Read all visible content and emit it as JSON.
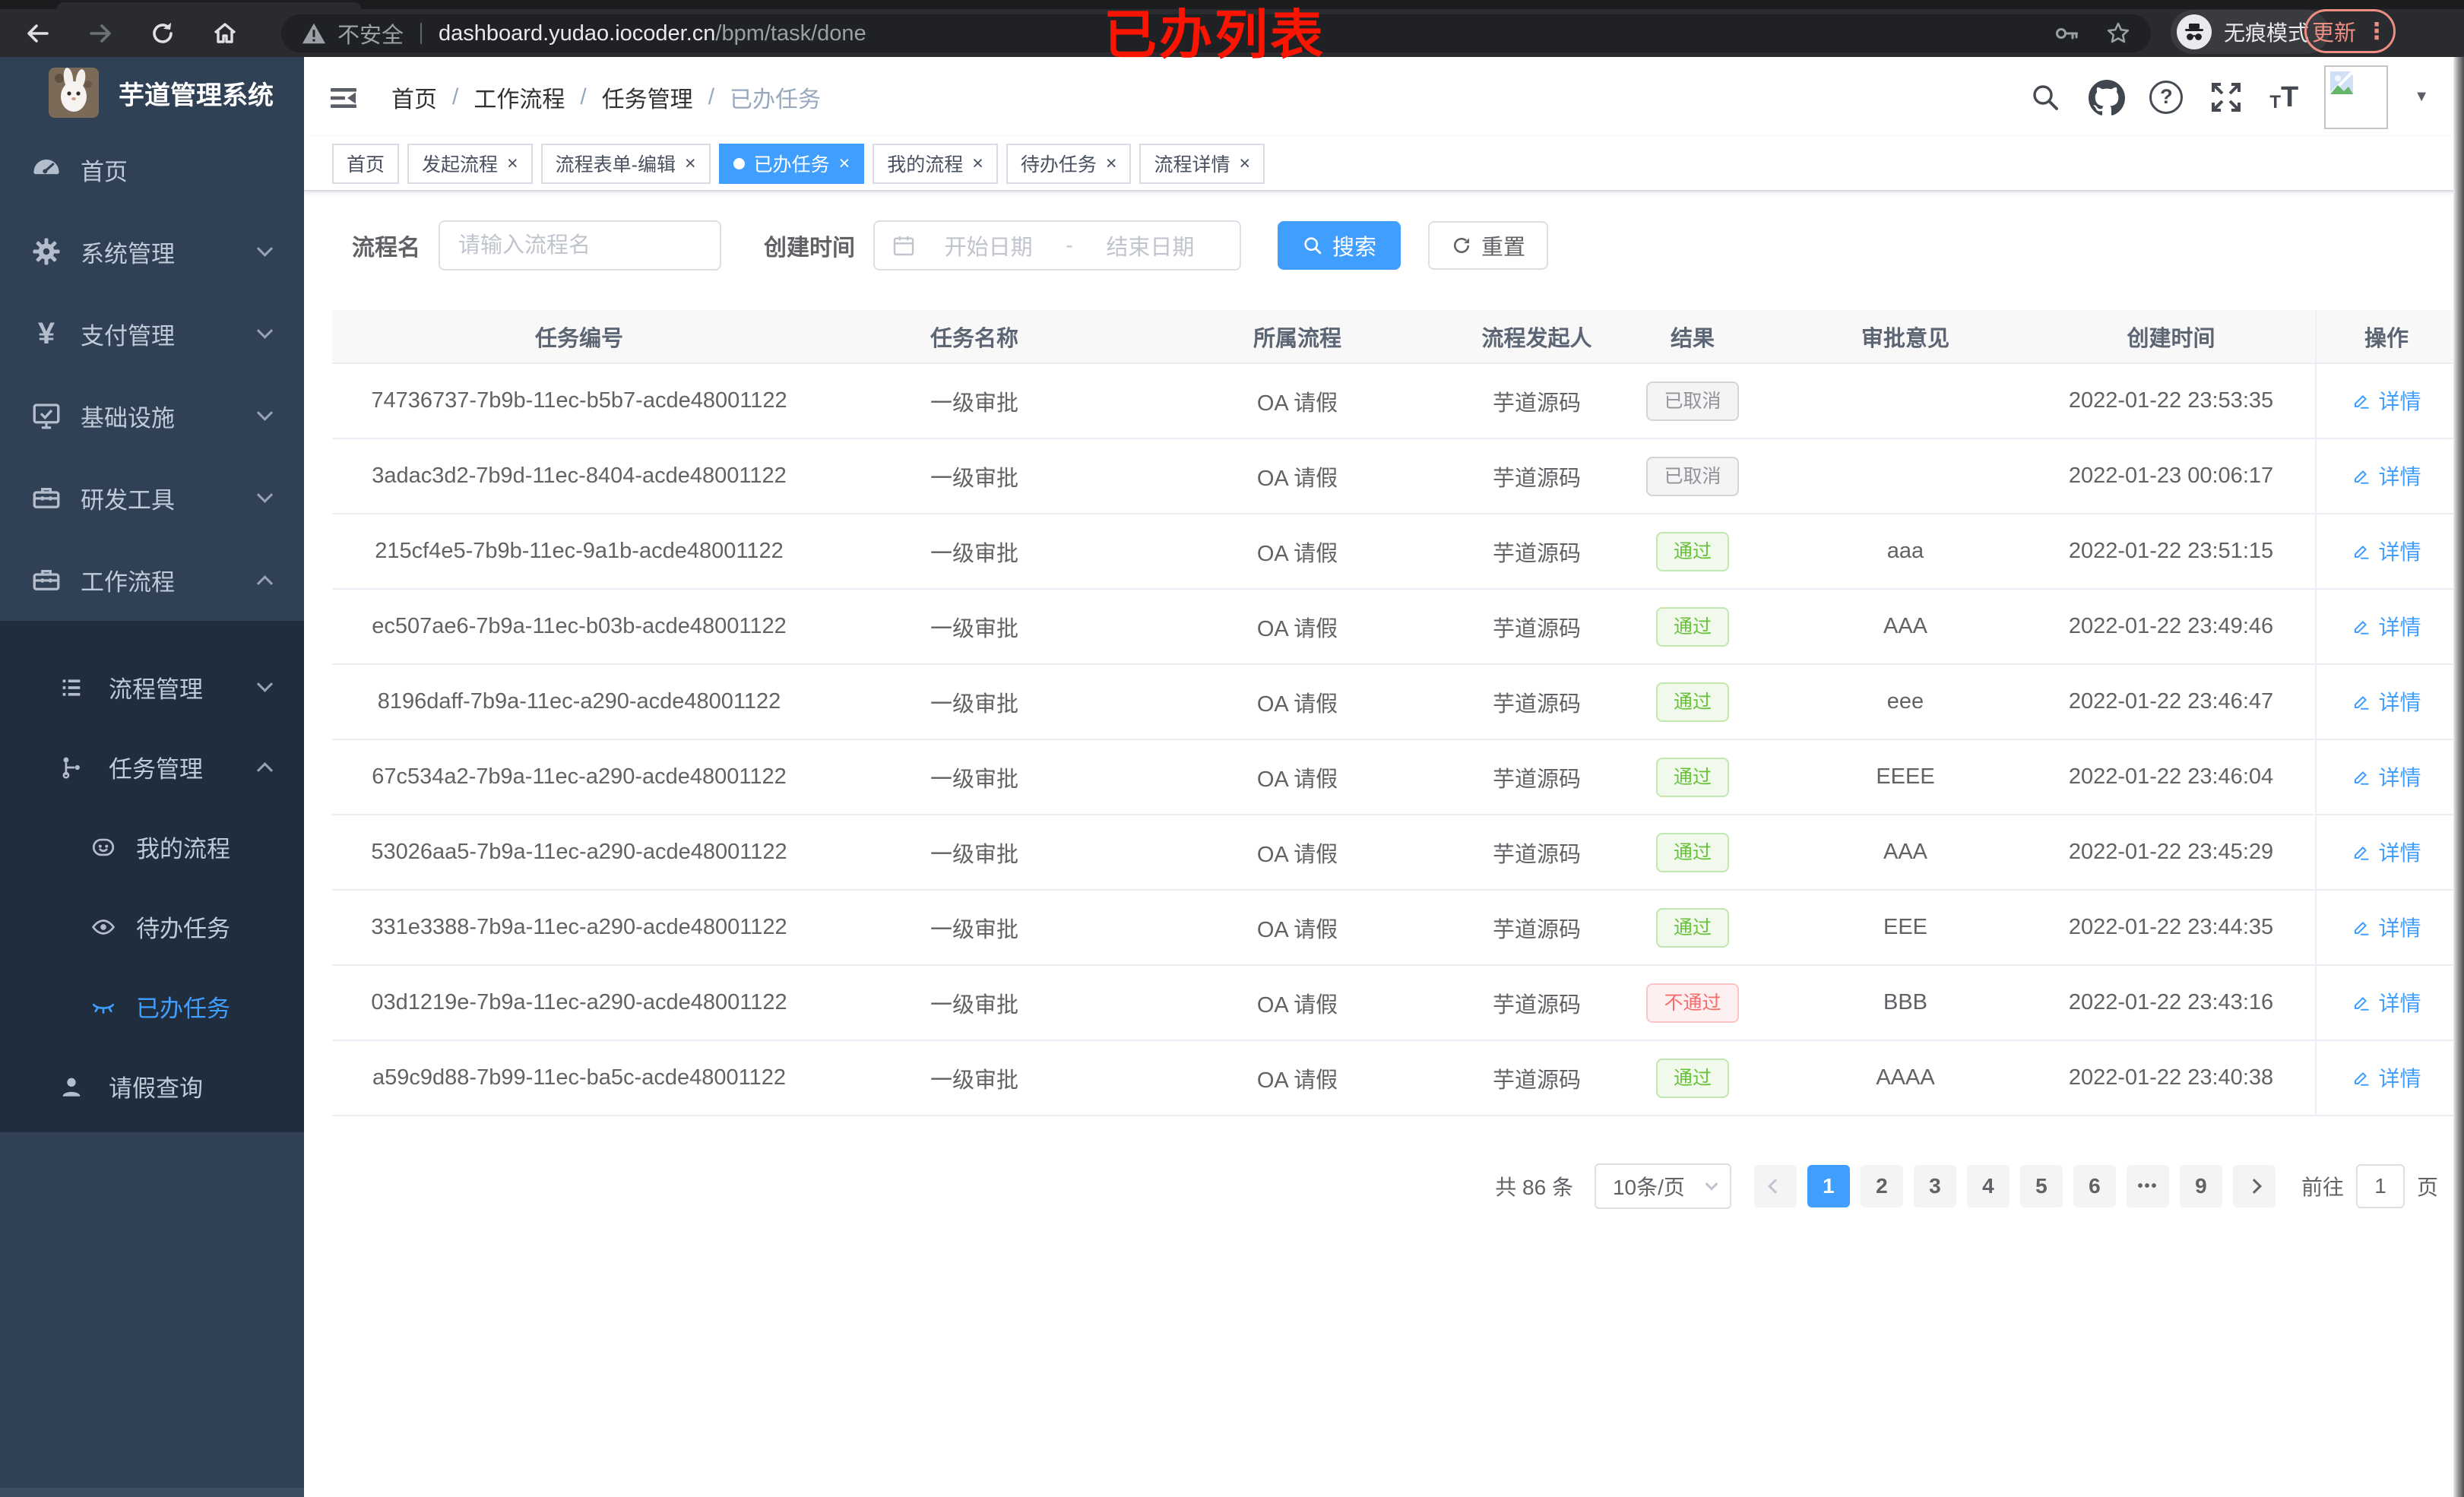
{
  "browser": {
    "security_label": "不安全",
    "url_host": "dashboard.yudao.iocoder.cn",
    "url_path": "/bpm/task/done",
    "incognito_label": "无痕模式",
    "update_label": "更新",
    "annotation": "已办列表"
  },
  "glyphs": {
    "close": "×",
    "dots_vertical": "⋮",
    "caret_down": "▼"
  },
  "icons": {
    "browser": [
      "back-arrow",
      "forward-arrow",
      "reload",
      "home",
      "warning-triangle",
      "key",
      "star",
      "incognito-hat-glasses",
      "kebab-dots"
    ],
    "navbar": [
      "hamburger-fold",
      "search",
      "github",
      "question",
      "fullscreen",
      "text-size",
      "broken-image-avatar",
      "caret-down"
    ],
    "sidebar": [
      "gauge",
      "gear",
      "yen",
      "monitor-check",
      "toolbox",
      "list",
      "flow-tree",
      "face",
      "eye",
      "eye-closed",
      "person"
    ],
    "actions": [
      "magnifier",
      "refresh",
      "calendar",
      "pen-edit"
    ]
  },
  "sidebar": {
    "logo_title": "芋道管理系统",
    "items": [
      {
        "label": "首页"
      },
      {
        "label": "系统管理",
        "chevron": "down"
      },
      {
        "label": "支付管理",
        "chevron": "down"
      },
      {
        "label": "基础设施",
        "chevron": "down"
      },
      {
        "label": "研发工具",
        "chevron": "down"
      },
      {
        "label": "工作流程",
        "chevron": "up"
      }
    ],
    "submenu": [
      {
        "label": "流程管理",
        "chevron": "down"
      },
      {
        "label": "任务管理",
        "chevron": "up"
      },
      {
        "label": "我的流程"
      },
      {
        "label": "待办任务"
      },
      {
        "label": "已办任务",
        "active": true
      },
      {
        "label": "请假查询"
      }
    ]
  },
  "breadcrumb": {
    "separator": "/",
    "items": [
      "首页",
      "工作流程",
      "任务管理",
      "已办任务"
    ]
  },
  "tabs": [
    {
      "label": "首页",
      "closable": false,
      "active": false
    },
    {
      "label": "发起流程",
      "closable": true,
      "active": false
    },
    {
      "label": "流程表单-编辑",
      "closable": true,
      "active": false
    },
    {
      "label": "已办任务",
      "closable": true,
      "active": true
    },
    {
      "label": "我的流程",
      "closable": true,
      "active": false
    },
    {
      "label": "待办任务",
      "closable": true,
      "active": false
    },
    {
      "label": "流程详情",
      "closable": true,
      "active": false
    }
  ],
  "filters": {
    "process_name_label": "流程名",
    "process_name_placeholder": "请输入流程名",
    "create_time_label": "创建时间",
    "start_placeholder": "开始日期",
    "range_separator": "-",
    "end_placeholder": "结束日期",
    "search_label": "搜索",
    "reset_label": "重置"
  },
  "table": {
    "columns": [
      "任务编号",
      "任务名称",
      "所属流程",
      "流程发起人",
      "结果",
      "审批意见",
      "创建时间",
      "操作"
    ],
    "detail_label": "详情",
    "rows": [
      {
        "id": "74736737-7b9b-11ec-b5b7-acde48001122",
        "name": "一级审批",
        "process": "OA 请假",
        "starter": "芋道源码",
        "result": "已取消",
        "result_type": "info",
        "opinion": "",
        "created": "2022-01-22 23:53:35"
      },
      {
        "id": "3adac3d2-7b9d-11ec-8404-acde48001122",
        "name": "一级审批",
        "process": "OA 请假",
        "starter": "芋道源码",
        "result": "已取消",
        "result_type": "info",
        "opinion": "",
        "created": "2022-01-23 00:06:17"
      },
      {
        "id": "215cf4e5-7b9b-11ec-9a1b-acde48001122",
        "name": "一级审批",
        "process": "OA 请假",
        "starter": "芋道源码",
        "result": "通过",
        "result_type": "success",
        "opinion": "aaa",
        "created": "2022-01-22 23:51:15"
      },
      {
        "id": "ec507ae6-7b9a-11ec-b03b-acde48001122",
        "name": "一级审批",
        "process": "OA 请假",
        "starter": "芋道源码",
        "result": "通过",
        "result_type": "success",
        "opinion": "AAA",
        "created": "2022-01-22 23:49:46"
      },
      {
        "id": "8196daff-7b9a-11ec-a290-acde48001122",
        "name": "一级审批",
        "process": "OA 请假",
        "starter": "芋道源码",
        "result": "通过",
        "result_type": "success",
        "opinion": "eee",
        "created": "2022-01-22 23:46:47"
      },
      {
        "id": "67c534a2-7b9a-11ec-a290-acde48001122",
        "name": "一级审批",
        "process": "OA 请假",
        "starter": "芋道源码",
        "result": "通过",
        "result_type": "success",
        "opinion": "EEEE",
        "created": "2022-01-22 23:46:04"
      },
      {
        "id": "53026aa5-7b9a-11ec-a290-acde48001122",
        "name": "一级审批",
        "process": "OA 请假",
        "starter": "芋道源码",
        "result": "通过",
        "result_type": "success",
        "opinion": "AAA",
        "created": "2022-01-22 23:45:29"
      },
      {
        "id": "331e3388-7b9a-11ec-a290-acde48001122",
        "name": "一级审批",
        "process": "OA 请假",
        "starter": "芋道源码",
        "result": "通过",
        "result_type": "success",
        "opinion": "EEE",
        "created": "2022-01-22 23:44:35"
      },
      {
        "id": "03d1219e-7b9a-11ec-a290-acde48001122",
        "name": "一级审批",
        "process": "OA 请假",
        "starter": "芋道源码",
        "result": "不通过",
        "result_type": "danger",
        "opinion": "BBB",
        "created": "2022-01-22 23:43:16"
      },
      {
        "id": "a59c9d88-7b99-11ec-ba5c-acde48001122",
        "name": "一级审批",
        "process": "OA 请假",
        "starter": "芋道源码",
        "result": "通过",
        "result_type": "success",
        "opinion": "AAAA",
        "created": "2022-01-22 23:40:38"
      }
    ]
  },
  "pagination": {
    "total": "共 86 条",
    "page_size": "10条/页",
    "pages": [
      "1",
      "2",
      "3",
      "4",
      "5",
      "6"
    ],
    "ellipsis": "•••",
    "last_page": "9",
    "active_page": "1",
    "goto_label": "前往",
    "goto_value": "1",
    "goto_unit": "页"
  }
}
